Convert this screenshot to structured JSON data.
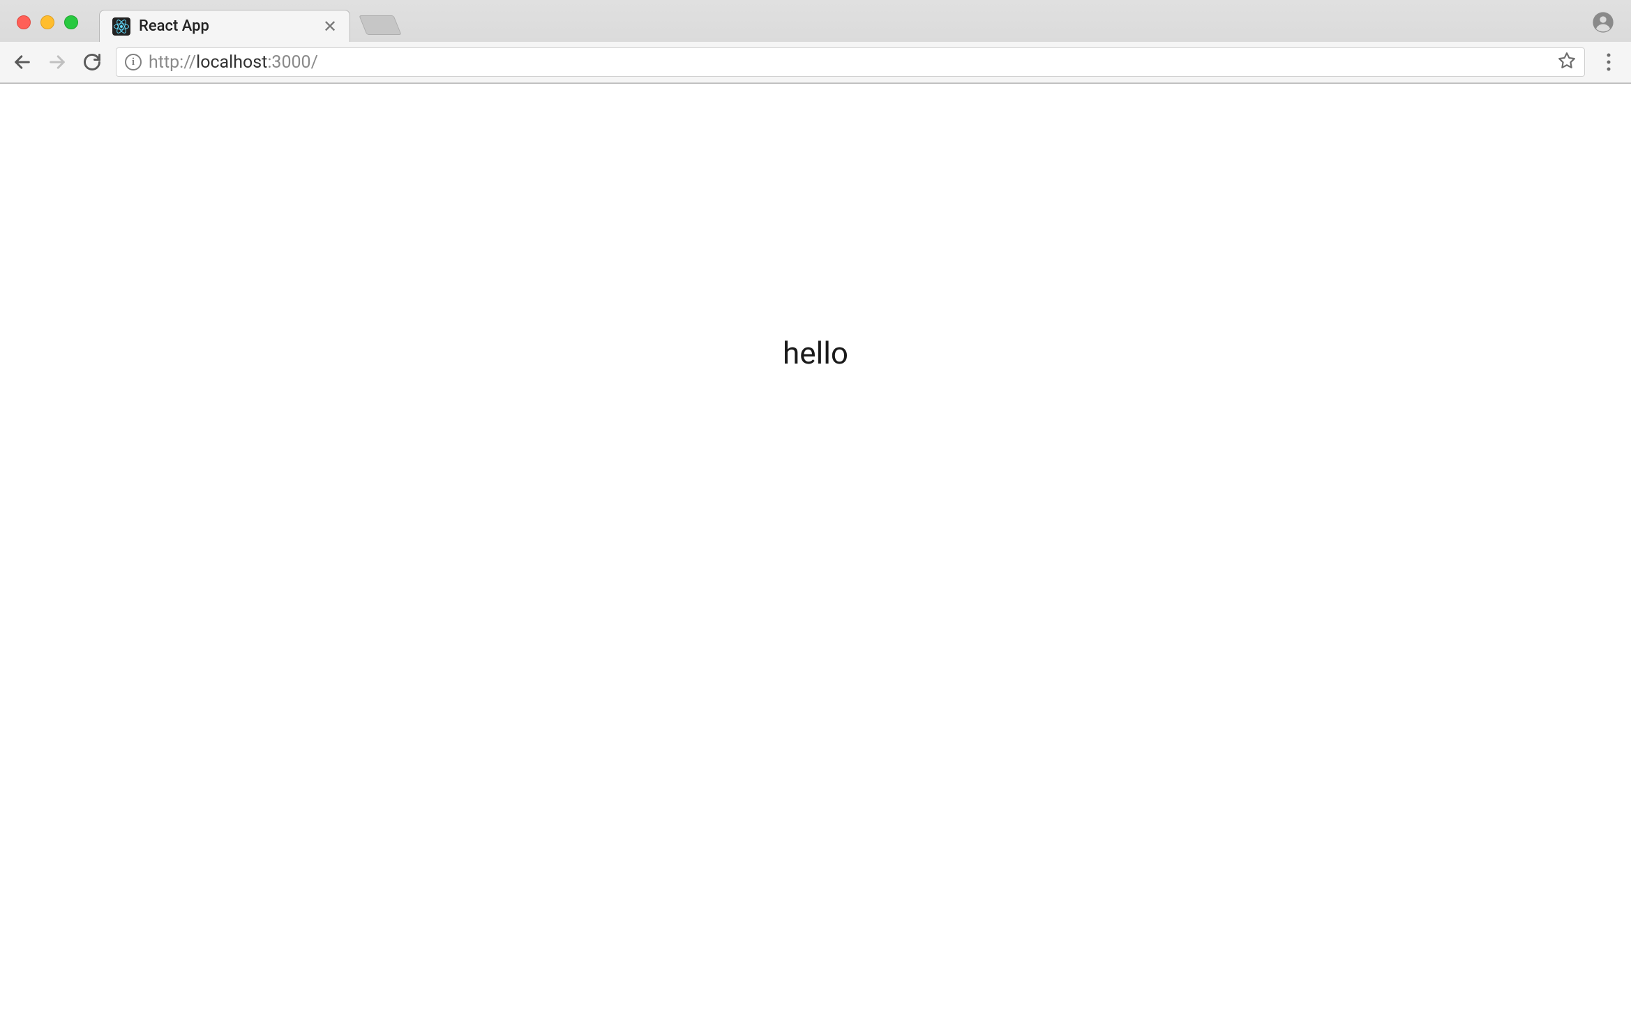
{
  "browser": {
    "tab": {
      "title": "React App"
    },
    "url": {
      "protocol": "http://",
      "host": "localhost",
      "port_path": ":3000/"
    }
  },
  "page": {
    "text": "hello"
  }
}
